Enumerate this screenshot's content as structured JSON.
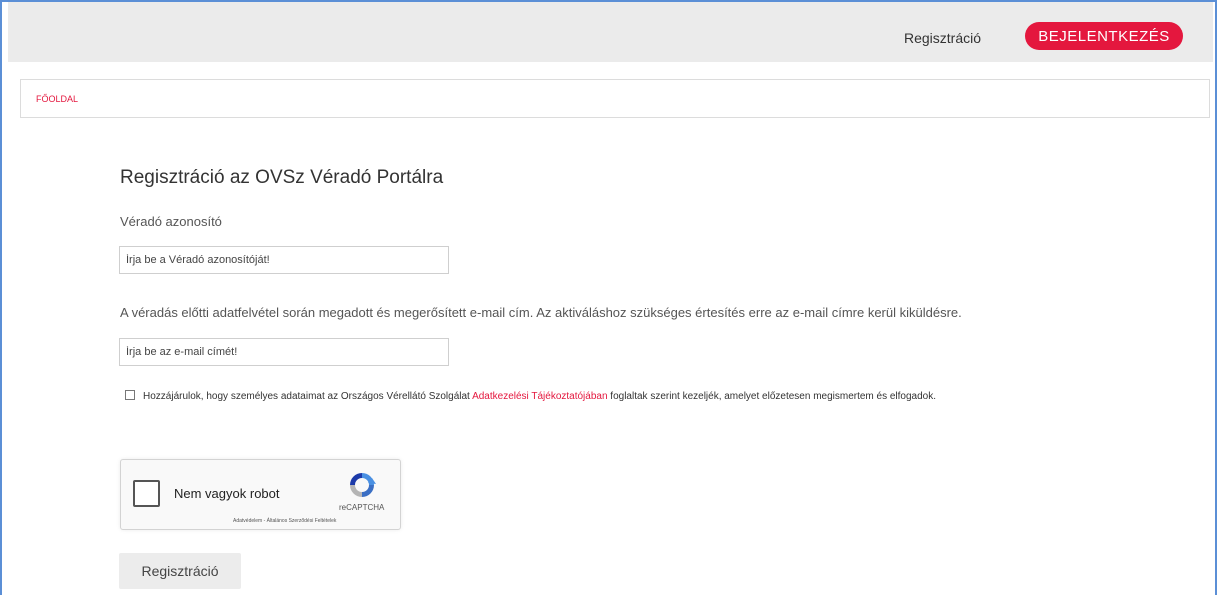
{
  "header": {
    "register_link": "Regisztráció",
    "login_button": "BEJELENTKEZÉS"
  },
  "breadcrumb": {
    "home": "FŐOLDAL"
  },
  "form": {
    "title": "Regisztráció az OVSz Véradó Portálra",
    "donor_id_label": "Véradó azonosító",
    "donor_id_placeholder": "Írja be a Véradó azonosítóját!",
    "donor_id_value": "",
    "email_note": "A véradás előtti adatfelvétel során megadott és megerősített e-mail cím. Az aktiváláshoz szükséges értesítés erre az e-mail címre kerül kiküldésre.",
    "email_placeholder": "Írja be az e-mail címét!",
    "email_value": "",
    "consent_checked": false,
    "consent_before": "Hozzájárulok, hogy személyes adataimat az Országos Vérellátó Szolgálat ",
    "consent_link": "Adatkezelési Tájékoztatójában",
    "consent_after": " foglaltak szerint kezeljék, amelyet előzetesen megismertem és elfogadok.",
    "submit_label": "Regisztráció"
  },
  "captcha": {
    "label": "Nem vagyok robot",
    "brand": "reCAPTCHA",
    "terms": "Adatvédelem - Általános Szerződési Feltételek",
    "logo_icon": "recaptcha-icon",
    "checked": false
  },
  "colors": {
    "accent": "#e4173e",
    "topbar": "#ebebeb"
  }
}
